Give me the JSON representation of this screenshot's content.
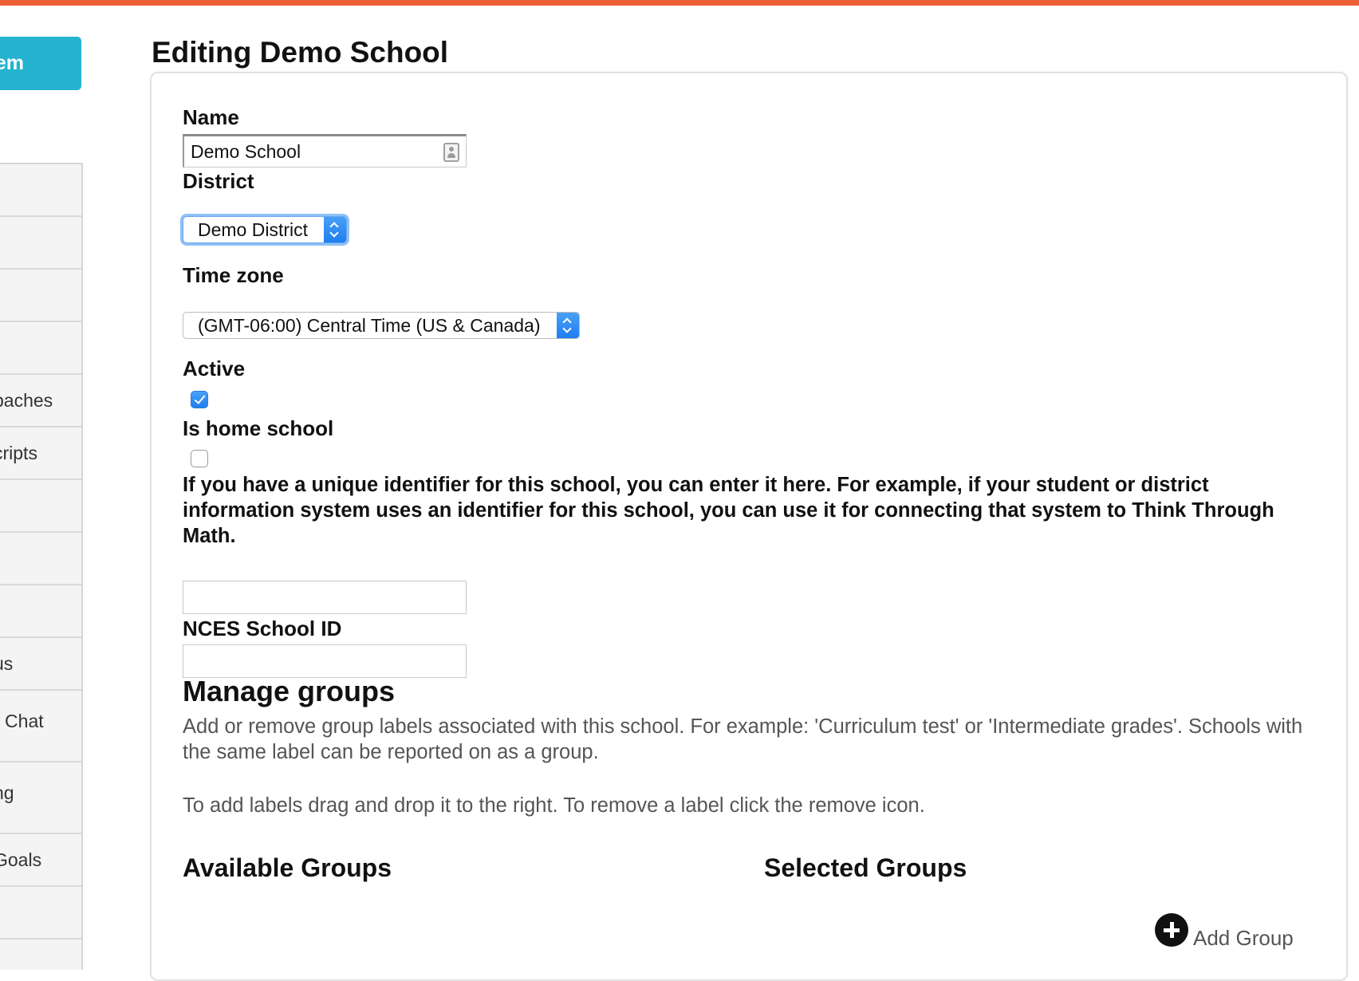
{
  "header": {
    "accent_color": "#ec5f35"
  },
  "sidebar": {
    "top_button": {
      "label": "em",
      "color": "#24b4cf"
    },
    "items": [
      {
        "label": ""
      },
      {
        "label": ""
      },
      {
        "label": ""
      },
      {
        "label": ""
      },
      {
        "label": "paches"
      },
      {
        "label": "cripts"
      },
      {
        "label": ""
      },
      {
        "label": ""
      },
      {
        "label": ""
      },
      {
        "label": "us"
      },
      {
        "label": "r Chat"
      },
      {
        "label": "ng"
      },
      {
        "label": "Goals"
      },
      {
        "label": ""
      }
    ]
  },
  "page": {
    "title": "Editing Demo School"
  },
  "form": {
    "name": {
      "label": "Name",
      "value": "Demo School"
    },
    "district": {
      "label": "District",
      "selected": "Demo District"
    },
    "timezone": {
      "label": "Time zone",
      "selected": "(GMT-06:00) Central Time (US & Canada)"
    },
    "active": {
      "label": "Active",
      "checked": true
    },
    "home_school": {
      "label": "Is home school",
      "checked": false
    },
    "identifier": {
      "help": "If you have a unique identifier for this school, you can enter it here. For example, if your student or district information system uses an identifier for this school, you can use it for connecting that system to Think Through Math.",
      "value": ""
    },
    "nces": {
      "label": "NCES School ID",
      "value": ""
    }
  },
  "groups": {
    "title": "Manage groups",
    "description": "Add or remove group labels associated with this school. For example: 'Curriculum test' or 'Intermediate grades'. Schools with the same label can be reported on as a group.",
    "instructions": "To add labels drag and drop it to the right. To remove a label click the remove icon.",
    "available_heading": "Available Groups",
    "selected_heading": "Selected Groups",
    "add_label": "Add Group"
  }
}
